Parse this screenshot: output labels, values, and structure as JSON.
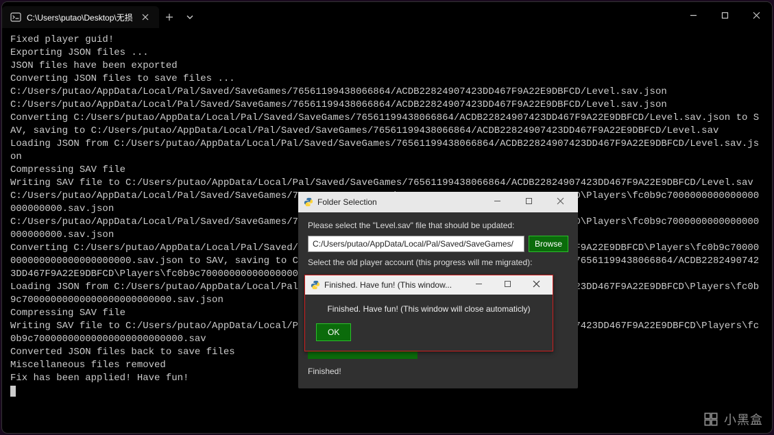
{
  "window": {
    "tab_title": "C:\\Users\\putao\\Desktop\\无损",
    "icons": {
      "tab": "terminal-icon",
      "close": "close-icon",
      "newtab": "plus-icon",
      "dropdown": "chevron-down-icon",
      "min": "minimize-icon",
      "max": "maximize-icon",
      "win_close": "close-icon"
    }
  },
  "terminal_lines": [
    "Fixed player guid!",
    "Exporting JSON files ...",
    "JSON files have been exported",
    "Converting JSON files to save files ...",
    "C:/Users/putao/AppData/Local/Pal/Saved/SaveGames/76561199438066864/ACDB22824907423DD467F9A22E9DBFCD/Level.sav.json",
    "C:/Users/putao/AppData/Local/Pal/Saved/SaveGames/76561199438066864/ACDB22824907423DD467F9A22E9DBFCD/Level.sav.json",
    "Converting C:/Users/putao/AppData/Local/Pal/Saved/SaveGames/76561199438066864/ACDB22824907423DD467F9A22E9DBFCD/Level.sav.json to SAV, saving to C:/Users/putao/AppData/Local/Pal/Saved/SaveGames/76561199438066864/ACDB22824907423DD467F9A22E9DBFCD/Level.sav",
    "Loading JSON from C:/Users/putao/AppData/Local/Pal/Saved/SaveGames/76561199438066864/ACDB22824907423DD467F9A22E9DBFCD/Level.sav.json",
    "Compressing SAV file",
    "Writing SAV file to C:/Users/putao/AppData/Local/Pal/Saved/SaveGames/76561199438066864/ACDB22824907423DD467F9A22E9DBFCD/Level.sav",
    "C:/Users/putao/AppData/Local/Pal/Saved/SaveGames/76561199438066864/ACDB22824907423DD467F9A22E9DBFCD\\Players\\fc0b9c7000000000000000000000000.sav.json",
    "C:/Users/putao/AppData/Local/Pal/Saved/SaveGames/76561199438066864/ACDB22824907423DD467F9A22E9DBFCD\\Players\\fc0b9c7000000000000000000000000.sav.json",
    "Converting C:/Users/putao/AppData/Local/Pal/Saved/SaveGames/76561199438066864/ACDB22824907423DD467F9A22E9DBFCD\\Players\\fc0b9c70000000000000000000000000.sav.json to SAV, saving to C:/Users/putao/AppData/Local/Pal/Saved/SaveGames/76561199438066864/ACDB22824907423DD467F9A22E9DBFCD\\Players\\fc0b9c70000000000000000000000000.sav",
    "Loading JSON from C:/Users/putao/AppData/Local/Pal/Saved/SaveGames/76561199438066864/ACDB22824907423DD467F9A22E9DBFCD\\Players\\fc0b9c70000000000000000000000000.sav.json",
    "Compressing SAV file",
    "Writing SAV file to C:/Users/putao/AppData/Local/Pal/Saved/SaveGames/76561199438066864/ACDB22824907423DD467F9A22E9DBFCD\\Players\\fc0b9c70000000000000000000000000.sav",
    "Converted JSON files back to save files",
    "Miscellaneous files removed",
    "Fix has been applied! Have fun!"
  ],
  "dlg1": {
    "title": "Folder Selection",
    "label1": "Please select the \"Level.sav\" file that should be updated:",
    "path_value": "C:/Users/putao/AppData/Local/Pal/Saved/SaveGames/",
    "browse": "Browse",
    "label2": "Select the old player account (this progress will me migrated):",
    "finished": "Finished!"
  },
  "dlg2": {
    "title": "Finished. Have fun! (This window...",
    "message": "Finished. Have fun! (This window will close automaticly)",
    "ok": "OK"
  },
  "watermark": {
    "text": "小黑盒"
  }
}
